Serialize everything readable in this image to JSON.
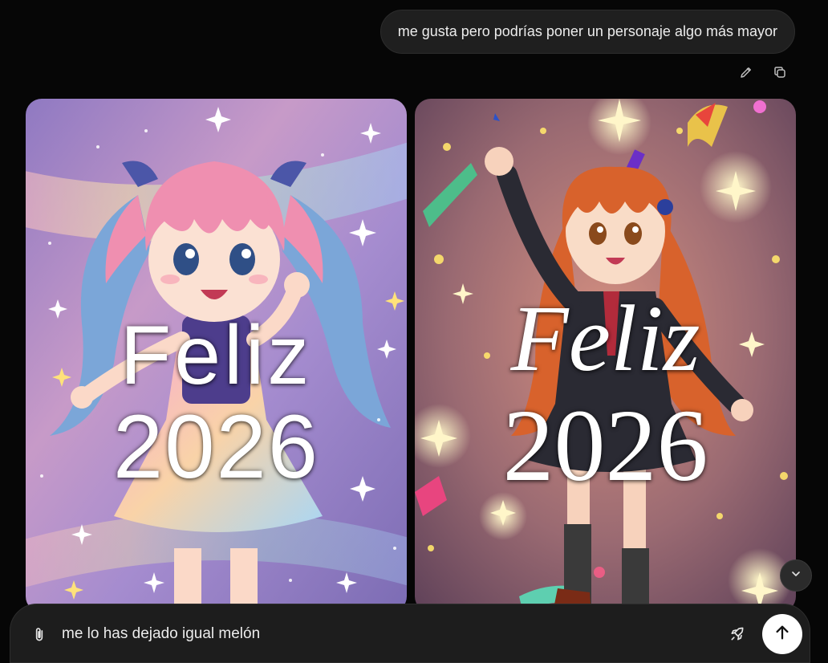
{
  "user_message": {
    "text": "me gusta pero podrías poner un personaje algo más mayor"
  },
  "actions": {
    "edit_icon": "pencil-icon",
    "copy_icon": "copy-icon"
  },
  "images": [
    {
      "line1": "Feliz",
      "line2": "2026",
      "style": "pastel magical-girl with twin tails"
    },
    {
      "line1": "Feliz",
      "line2": "2026",
      "style": "older anime girl in school uniform waving"
    }
  ],
  "composer": {
    "value": "me lo has dejado igual melón",
    "attach_icon": "paperclip-icon",
    "tool_icon": "rocket-icon",
    "send_icon": "arrow-up-icon"
  },
  "scroll_icon": "chevron-down-icon"
}
